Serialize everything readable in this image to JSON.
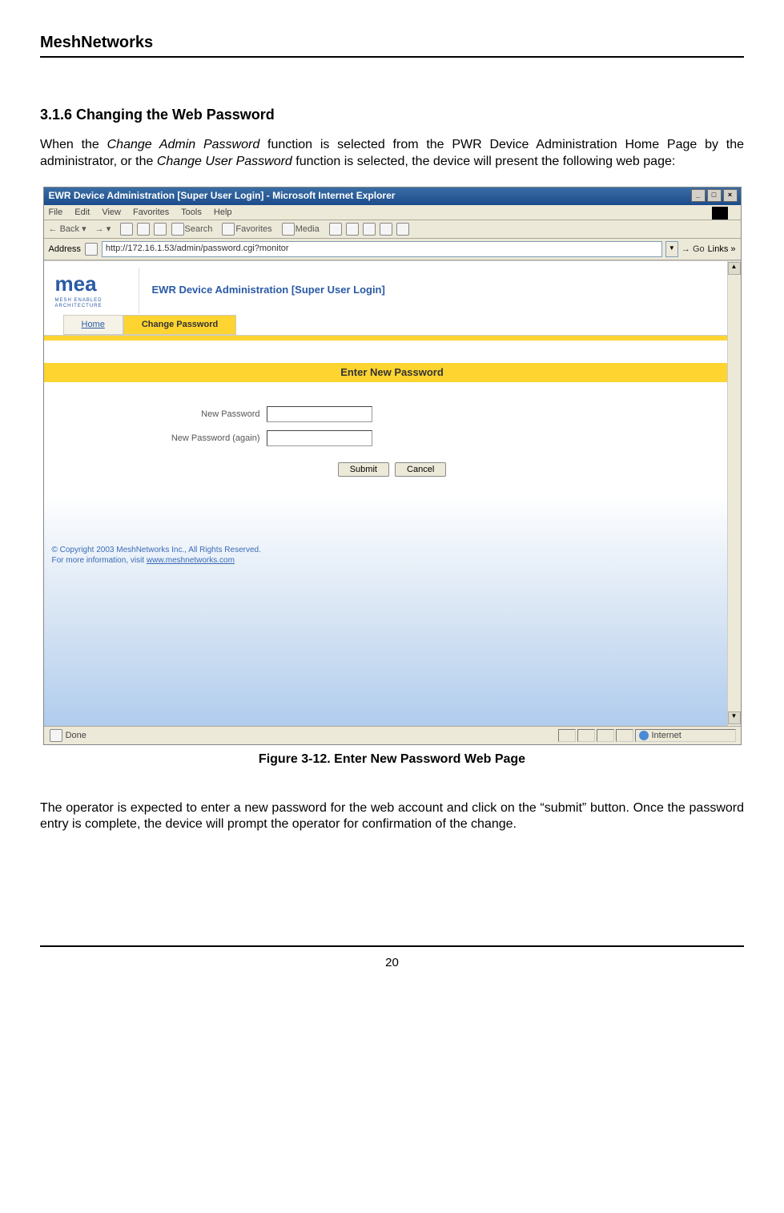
{
  "doc": {
    "brand": "MeshNetworks",
    "section_title": "3.1.6  Changing the Web Password",
    "para1_before": "When the ",
    "para1_italic1": "Change Admin Password",
    "para1_mid": " function is selected from the PWR Device Administration Home Page by the administrator, or the ",
    "para1_italic2": "Change User Password",
    "para1_after": " function is selected, the device will present the following web page:",
    "figure_caption": "Figure 3-12.     Enter New Password Web Page",
    "para2": "The operator is expected to enter a new password for the web account and click on the “submit” button. Once the password entry is complete, the device will prompt the operator for confirmation of the change.",
    "page_number": "20"
  },
  "browser": {
    "window_title": "EWR Device Administration [Super User Login] - Microsoft Internet Explorer",
    "menu": {
      "file": "File",
      "edit": "Edit",
      "view": "View",
      "favorites": "Favorites",
      "tools": "Tools",
      "help": "Help"
    },
    "toolbar": {
      "back": "Back",
      "search": "Search",
      "favorites": "Favorites",
      "media": "Media"
    },
    "address_label": "Address",
    "address_value": "http://172.16.1.53/admin/password.cgi?monitor",
    "go": "Go",
    "links": "Links »",
    "status_done": "Done",
    "status_zone": "Internet"
  },
  "page": {
    "logo_main": "mea",
    "logo_sub": "MESH ENABLED ARCHITECTURE",
    "inner_title": "EWR Device Administration [Super User Login]",
    "tab_home": "Home",
    "tab_change": "Change Password",
    "form_heading": "Enter New Password",
    "label_new": "New Password",
    "label_again": "New Password (again)",
    "btn_submit": "Submit",
    "btn_cancel": "Cancel",
    "copyright_line1": "© Copyright 2003 MeshNetworks Inc., All Rights Reserved.",
    "copyright_line2_pre": "For more information, visit ",
    "copyright_link": "www.meshnetworks.com"
  }
}
